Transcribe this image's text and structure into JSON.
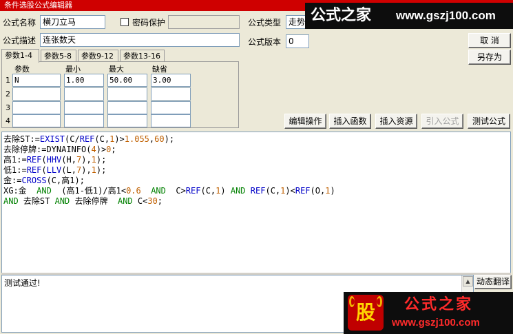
{
  "window": {
    "title": "条件选股公式编辑器"
  },
  "form": {
    "name_label": "公式名称",
    "name_value": "横刀立马",
    "password_label": "密码保护",
    "password_checked": false,
    "type_label": "公式类型",
    "type_value": "走势",
    "desc_label": "公式描述",
    "desc_value": "连张数天",
    "version_label": "公式版本",
    "version_value": "0"
  },
  "tabs": [
    "参数1-4",
    "参数5-8",
    "参数9-12",
    "参数13-16"
  ],
  "params": {
    "headers": [
      "参数",
      "最小",
      "最大",
      "缺省"
    ],
    "rows": [
      {
        "num": "1",
        "name": "N",
        "min": "1.00",
        "max": "50.00",
        "default": "3.00"
      },
      {
        "num": "2",
        "name": "",
        "min": "",
        "max": "",
        "default": ""
      },
      {
        "num": "3",
        "name": "",
        "min": "",
        "max": "",
        "default": ""
      },
      {
        "num": "4",
        "name": "",
        "min": "",
        "max": "",
        "default": ""
      }
    ]
  },
  "buttons": {
    "cancel": "取  消",
    "save_as": "另存为",
    "edit_ops": "编辑操作",
    "insert_func": "插入函数",
    "insert_resource": "插入资源",
    "import_formula": "引入公式",
    "test_formula": "测试公式",
    "translate": "动态翻译"
  },
  "code_lines": [
    [
      [
        "去除ST:=",
        "#000"
      ],
      [
        "EXIST",
        "#0000c8"
      ],
      [
        "(C/",
        "#000"
      ],
      [
        "REF",
        "#0000c8"
      ],
      [
        "(C,",
        "#000"
      ],
      [
        "1",
        "#c06000"
      ],
      [
        ")>",
        "#000"
      ],
      [
        "1.055",
        "#c06000"
      ],
      [
        ",",
        "#000"
      ],
      [
        "60",
        "#c06000"
      ],
      [
        ");",
        "#000"
      ]
    ],
    [
      [
        "去除停牌:=DYNAINFO(",
        "#000"
      ],
      [
        "4",
        "#c06000"
      ],
      [
        ")>",
        "#000"
      ],
      [
        "0",
        "#c06000"
      ],
      [
        ";",
        "#000"
      ]
    ],
    [
      [
        "高1:=",
        "#000"
      ],
      [
        "REF",
        "#0000c8"
      ],
      [
        "(",
        "#000"
      ],
      [
        "HHV",
        "#0000c8"
      ],
      [
        "(H,",
        "#000"
      ],
      [
        "7",
        "#c06000"
      ],
      [
        "),",
        "#000"
      ],
      [
        "1",
        "#c06000"
      ],
      [
        ");",
        "#000"
      ]
    ],
    [
      [
        "低1:=",
        "#000"
      ],
      [
        "REF",
        "#0000c8"
      ],
      [
        "(",
        "#000"
      ],
      [
        "LLV",
        "#0000c8"
      ],
      [
        "(L,",
        "#000"
      ],
      [
        "7",
        "#c06000"
      ],
      [
        "),",
        "#000"
      ],
      [
        "1",
        "#c06000"
      ],
      [
        ");",
        "#000"
      ]
    ],
    [
      [
        "金:=",
        "#000"
      ],
      [
        "CROSS",
        "#0000c8"
      ],
      [
        "(C,高1);",
        "#000"
      ]
    ],
    [
      [
        "XG:金  ",
        "#000"
      ],
      [
        "AND",
        "#008000"
      ],
      [
        "  (高1-低1)/高1<",
        "#000"
      ],
      [
        "0.6",
        "#c06000"
      ],
      [
        "  ",
        "#000"
      ],
      [
        "AND",
        "#008000"
      ],
      [
        "  C>",
        "#000"
      ],
      [
        "REF",
        "#0000c8"
      ],
      [
        "(C,",
        "#000"
      ],
      [
        "1",
        "#c06000"
      ],
      [
        ") ",
        "#000"
      ],
      [
        "AND",
        "#008000"
      ],
      [
        " ",
        "#000"
      ],
      [
        "REF",
        "#0000c8"
      ],
      [
        "(C,",
        "#000"
      ],
      [
        "1",
        "#c06000"
      ],
      [
        ")<",
        "#000"
      ],
      [
        "REF",
        "#0000c8"
      ],
      [
        "(O,",
        "#000"
      ],
      [
        "1",
        "#c06000"
      ],
      [
        ")",
        "#000"
      ]
    ],
    [
      [
        "AND",
        "#008000"
      ],
      [
        " 去除ST ",
        "#000"
      ],
      [
        "AND",
        "#008000"
      ],
      [
        " 去除停牌  ",
        "#000"
      ],
      [
        "AND",
        "#008000"
      ],
      [
        " C<",
        "#000"
      ],
      [
        "30",
        "#c06000"
      ],
      [
        ";",
        "#000"
      ]
    ]
  ],
  "output": {
    "text": "测试通过!"
  },
  "watermark_top": {
    "brand": "公式之家",
    "url": "www.gszj100.com"
  },
  "watermark_bottom": {
    "logo_char": "股",
    "brand": "公式之家",
    "url": "www.gszj100.com"
  },
  "colors": {
    "title_bar": "#cf0000",
    "keyword": "#0000c8",
    "number": "#c06000",
    "operator": "#008000"
  }
}
